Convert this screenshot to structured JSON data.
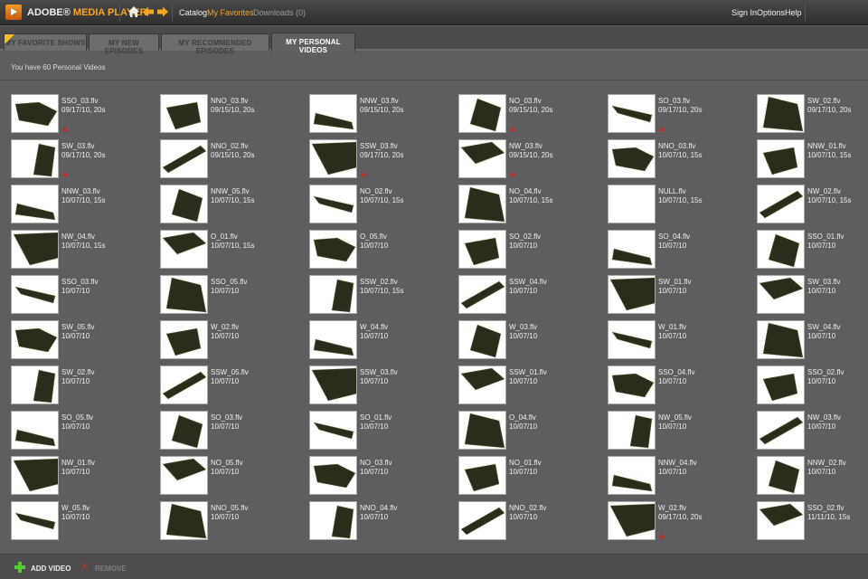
{
  "app": {
    "title_part1": "ADOBE®",
    "title_part2": "MEDIA PLAYER"
  },
  "topnav": {
    "catalog": "Catalog",
    "favorites": "My Favorites",
    "downloads": "Downloads (0)"
  },
  "topright": {
    "sign_in": "Sign In",
    "options": "Options",
    "help": "Help"
  },
  "tabs": [
    {
      "label": "MY FAVORITE SHOWS"
    },
    {
      "label": "MY NEW EPISODES"
    },
    {
      "label": "MY RECOMMENDED EPISODES"
    },
    {
      "label": "MY PERSONAL VIDEOS"
    }
  ],
  "active_tab": "MY PERSONAL VIDEOS",
  "video_count_text": "You have 60 Personal Videos",
  "colors": {
    "accent": "#f5a623",
    "background": "#5e5e5e",
    "flag": "#d0271d",
    "add": "#55cc35"
  },
  "videos": [
    {
      "name": "SSO_03.flv",
      "meta": "09/17/10, 20s",
      "flag": true
    },
    {
      "name": "NNO_03.flv",
      "meta": "09/15/10, 20s",
      "flag": false
    },
    {
      "name": "NNW_03.flv",
      "meta": "09/15/10, 20s",
      "flag": false
    },
    {
      "name": "NO_03.flv",
      "meta": "09/15/10, 20s",
      "flag": true
    },
    {
      "name": "SO_03.flv",
      "meta": "09/17/10, 20s",
      "flag": true
    },
    {
      "name": "SW_02.flv",
      "meta": "09/17/10, 20s",
      "flag": false
    },
    {
      "name": "SW_03.flv",
      "meta": "09/17/10, 20s",
      "flag": true
    },
    {
      "name": "NNO_02.flv",
      "meta": "09/15/10, 20s",
      "flag": false
    },
    {
      "name": "SSW_03.flv",
      "meta": "09/17/10, 20s",
      "flag": true
    },
    {
      "name": "NW_03.flv",
      "meta": "09/15/10, 20s",
      "flag": true
    },
    {
      "name": "NNO_03.flv",
      "meta": "10/07/10, 15s",
      "flag": false
    },
    {
      "name": "NNW_01.flv",
      "meta": "10/07/10, 15s",
      "flag": false
    },
    {
      "name": "NNW_03.flv",
      "meta": "10/07/10, 15s",
      "flag": false
    },
    {
      "name": "NNW_05.flv",
      "meta": "10/07/10, 15s",
      "flag": false
    },
    {
      "name": "NO_02.flv",
      "meta": "10/07/10, 15s",
      "flag": false
    },
    {
      "name": "NO_04.flv",
      "meta": "10/07/10, 15s",
      "flag": false
    },
    {
      "name": "NULL.flv",
      "meta": "10/07/10, 15s",
      "flag": false
    },
    {
      "name": "NW_02.flv",
      "meta": "10/07/10, 15s",
      "flag": false
    },
    {
      "name": "NW_04.flv",
      "meta": "10/07/10, 15s",
      "flag": false
    },
    {
      "name": "O_01.flv",
      "meta": "10/07/10, 15s",
      "flag": false
    },
    {
      "name": "O_05.flv",
      "meta": "10/07/10",
      "flag": false
    },
    {
      "name": "SO_02.flv",
      "meta": "10/07/10",
      "flag": false
    },
    {
      "name": "SO_04.flv",
      "meta": "10/07/10",
      "flag": false
    },
    {
      "name": "SSO_01.flv",
      "meta": "10/07/10",
      "flag": false
    },
    {
      "name": "SSO_03.flv",
      "meta": "10/07/10",
      "flag": false
    },
    {
      "name": "SSO_05.flv",
      "meta": "10/07/10",
      "flag": false
    },
    {
      "name": "SSW_02.flv",
      "meta": "10/07/10, 15s",
      "flag": false
    },
    {
      "name": "SSW_04.flv",
      "meta": "10/07/10",
      "flag": false
    },
    {
      "name": "SW_01.flv",
      "meta": "10/07/10",
      "flag": false
    },
    {
      "name": "SW_03.flv",
      "meta": "10/07/10",
      "flag": false
    },
    {
      "name": "SW_05.flv",
      "meta": "10/07/10",
      "flag": false
    },
    {
      "name": "W_02.flv",
      "meta": "10/07/10",
      "flag": false
    },
    {
      "name": "W_04.flv",
      "meta": "10/07/10",
      "flag": false
    },
    {
      "name": "W_03.flv",
      "meta": "10/07/10",
      "flag": false
    },
    {
      "name": "W_01.flv",
      "meta": "10/07/10",
      "flag": false
    },
    {
      "name": "SW_04.flv",
      "meta": "10/07/10",
      "flag": false
    },
    {
      "name": "SW_02.flv",
      "meta": "10/07/10",
      "flag": false
    },
    {
      "name": "SSW_05.flv",
      "meta": "10/07/10",
      "flag": false
    },
    {
      "name": "SSW_03.flv",
      "meta": "10/07/10",
      "flag": false
    },
    {
      "name": "SSW_01.flv",
      "meta": "10/07/10",
      "flag": false
    },
    {
      "name": "SSO_04.flv",
      "meta": "10/07/10",
      "flag": false
    },
    {
      "name": "SSO_02.flv",
      "meta": "10/07/10",
      "flag": false
    },
    {
      "name": "SO_05.flv",
      "meta": "10/07/10",
      "flag": false
    },
    {
      "name": "SO_03.flv",
      "meta": "10/07/10",
      "flag": false
    },
    {
      "name": "SO_01.flv",
      "meta": "10/07/10",
      "flag": false
    },
    {
      "name": "O_04.flv",
      "meta": "10/07/10",
      "flag": false
    },
    {
      "name": "NW_05.flv",
      "meta": "10/07/10",
      "flag": false
    },
    {
      "name": "NW_03.flv",
      "meta": "10/07/10",
      "flag": false
    },
    {
      "name": "NW_01.flv",
      "meta": "10/07/10",
      "flag": false
    },
    {
      "name": "NO_05.flv",
      "meta": "10/07/10",
      "flag": false
    },
    {
      "name": "NO_03.flv",
      "meta": "10/07/10",
      "flag": false
    },
    {
      "name": "NO_01.flv",
      "meta": "10/07/10",
      "flag": false
    },
    {
      "name": "NNW_04.flv",
      "meta": "10/07/10",
      "flag": false
    },
    {
      "name": "NNW_02.flv",
      "meta": "10/07/10",
      "flag": false
    },
    {
      "name": "W_05.flv",
      "meta": "10/07/10",
      "flag": false
    },
    {
      "name": "NNO_05.flv",
      "meta": "10/07/10",
      "flag": false
    },
    {
      "name": "NNO_04.flv",
      "meta": "10/07/10",
      "flag": false
    },
    {
      "name": "NNO_02.flv",
      "meta": "10/07/10",
      "flag": false
    },
    {
      "name": "W_02.flv",
      "meta": "09/17/10, 20s",
      "flag": true
    },
    {
      "name": "SSO_02.flv",
      "meta": "11/11/10, 15s",
      "flag": false
    }
  ],
  "bottom": {
    "add_label": "ADD VIDEO",
    "remove_label": "REMOVE"
  }
}
